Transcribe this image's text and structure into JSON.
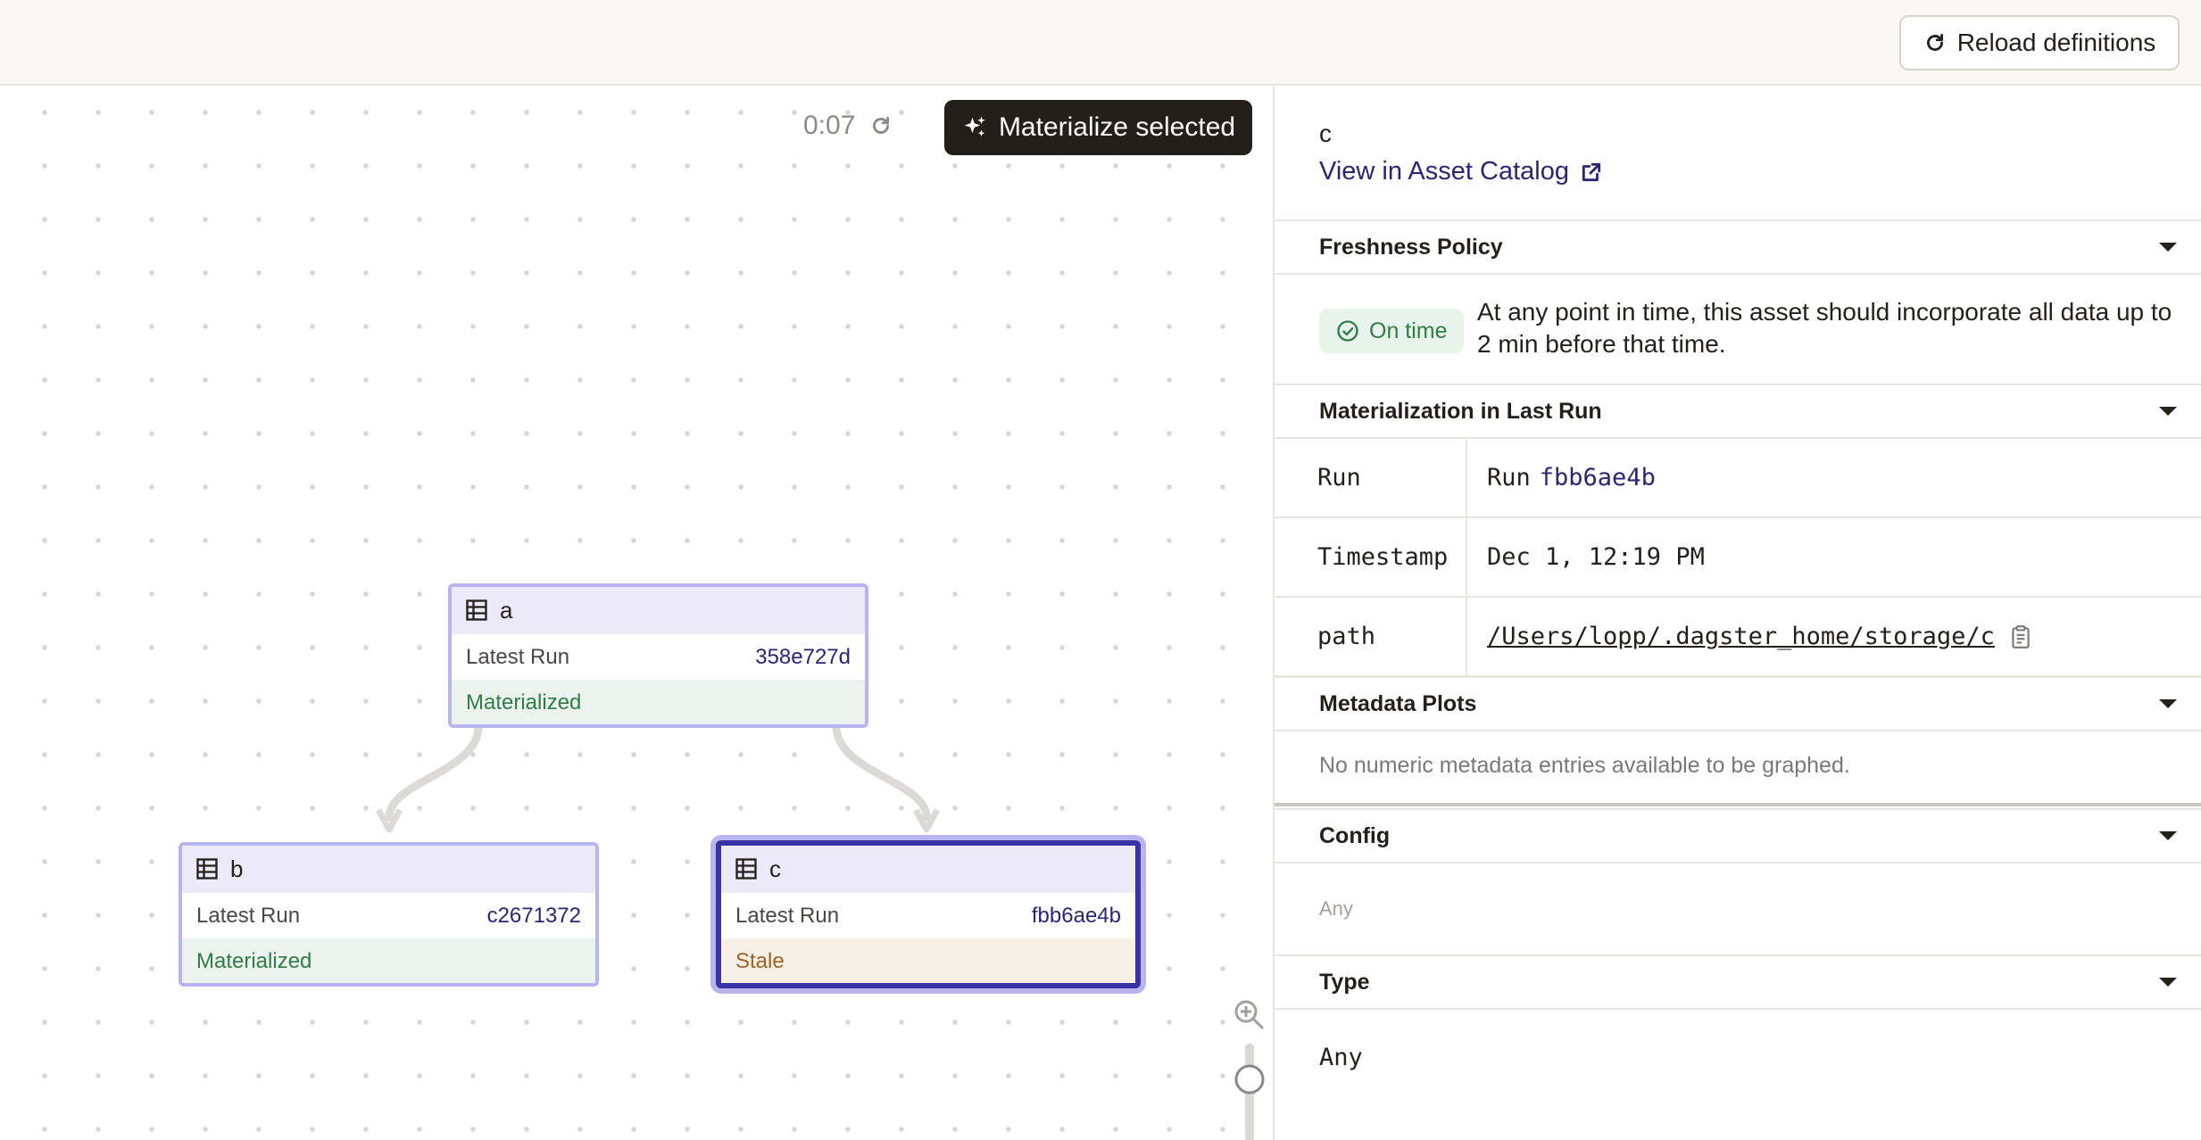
{
  "header": {
    "reload_label": "Reload definitions"
  },
  "canvas": {
    "timer": "0:07",
    "materialize_label": "Materialize selected",
    "nodes": [
      {
        "name": "a",
        "latest_run_label": "Latest Run",
        "run_id": "358e727d",
        "status": "Materialized"
      },
      {
        "name": "b",
        "latest_run_label": "Latest Run",
        "run_id": "c2671372",
        "status": "Materialized"
      },
      {
        "name": "c",
        "latest_run_label": "Latest Run",
        "run_id": "fbb6ae4b",
        "status": "Stale"
      }
    ]
  },
  "sidebar": {
    "asset_name": "c",
    "catalog_link": "View in Asset Catalog",
    "freshness": {
      "title": "Freshness Policy",
      "badge": "On time",
      "description": "At any point in time, this asset should incorporate all data up to 2 min before that time."
    },
    "materialization": {
      "title": "Materialization in Last Run",
      "rows": [
        {
          "key": "Run",
          "prefix": "Run",
          "value": "fbb6ae4b"
        },
        {
          "key": "Timestamp",
          "value": "Dec 1, 12:19 PM"
        },
        {
          "key": "path",
          "value": "/Users/lopp/.dagster_home/storage/c"
        }
      ]
    },
    "metadata_plots": {
      "title": "Metadata Plots",
      "empty": "No numeric metadata entries available to be graphed."
    },
    "config": {
      "title": "Config",
      "value": "Any"
    },
    "type": {
      "title": "Type",
      "value": "Any"
    }
  },
  "colors": {
    "node_border": "#b9b3ef",
    "node_selected_border": "#3a33a6",
    "materialized": "#2e7d46",
    "stale": "#a26224",
    "link": "#2b2578"
  },
  "icons": [
    "refresh-icon",
    "sparkles-icon",
    "table-icon",
    "external-link-icon",
    "check-circle-icon",
    "chevron-down-icon",
    "clipboard-icon",
    "zoom-in-icon"
  ]
}
